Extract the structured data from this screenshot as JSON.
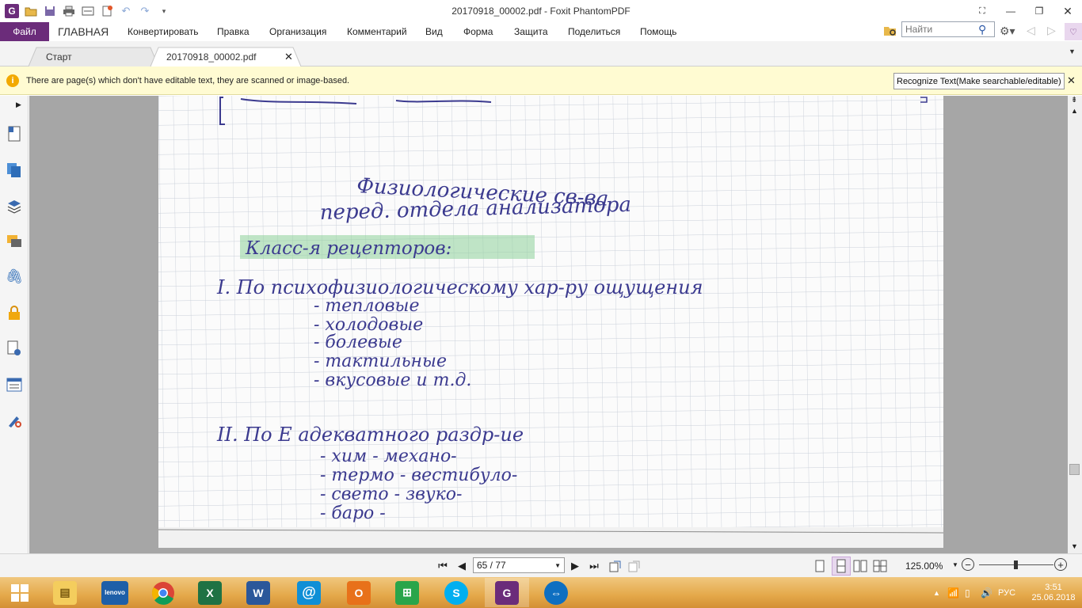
{
  "window": {
    "title": "20170918_00002.pdf - Foxit PhantomPDF"
  },
  "ribbon": {
    "file_label": "Файл",
    "menu": [
      "ГЛАВНАЯ",
      "Конвертировать",
      "Правка",
      "Организация",
      "Комментарий",
      "Вид",
      "Форма",
      "Защита",
      "Поделиться",
      "Помощь"
    ],
    "search_placeholder": "Найти"
  },
  "tabs": [
    {
      "label": "Старт",
      "active": false
    },
    {
      "label": "20170918_00002.pdf",
      "active": true
    }
  ],
  "notice": {
    "text": "There are page(s) which don't have editable text, they are scanned or image-based.",
    "button": "Recognize Text(Make searchable/editable)"
  },
  "document": {
    "handwriting": [
      "Физиологические св-ва",
      "перед. отдела анализатора",
      "Класс-я рецепторов:",
      "I. По психофизиологическому хар-ру ощущения",
      "- тепловые",
      "- холодовые",
      "- болевые",
      "- тактильные",
      "- вкусовые и т.д.",
      "II. По Е адекватного раздр-ие",
      "- хим - механо-",
      "- термо - вестибуло-",
      "- свето - звуко-",
      "- баро -"
    ]
  },
  "status": {
    "page_indicator": "65 / 77",
    "zoom": "125.00%"
  },
  "taskbar": {
    "language": "РУС",
    "time": "3:51",
    "date": "25.06.2018",
    "apps": [
      "file-explorer",
      "lenovo",
      "chrome",
      "excel",
      "word",
      "mail",
      "outlook",
      "store",
      "skype",
      "foxit",
      "teamviewer"
    ]
  },
  "colors": {
    "accent": "#6b2c7a",
    "notice_bg": "#fffbd2",
    "highlight": "#8ed19a",
    "ink": "#3b3a8f"
  }
}
